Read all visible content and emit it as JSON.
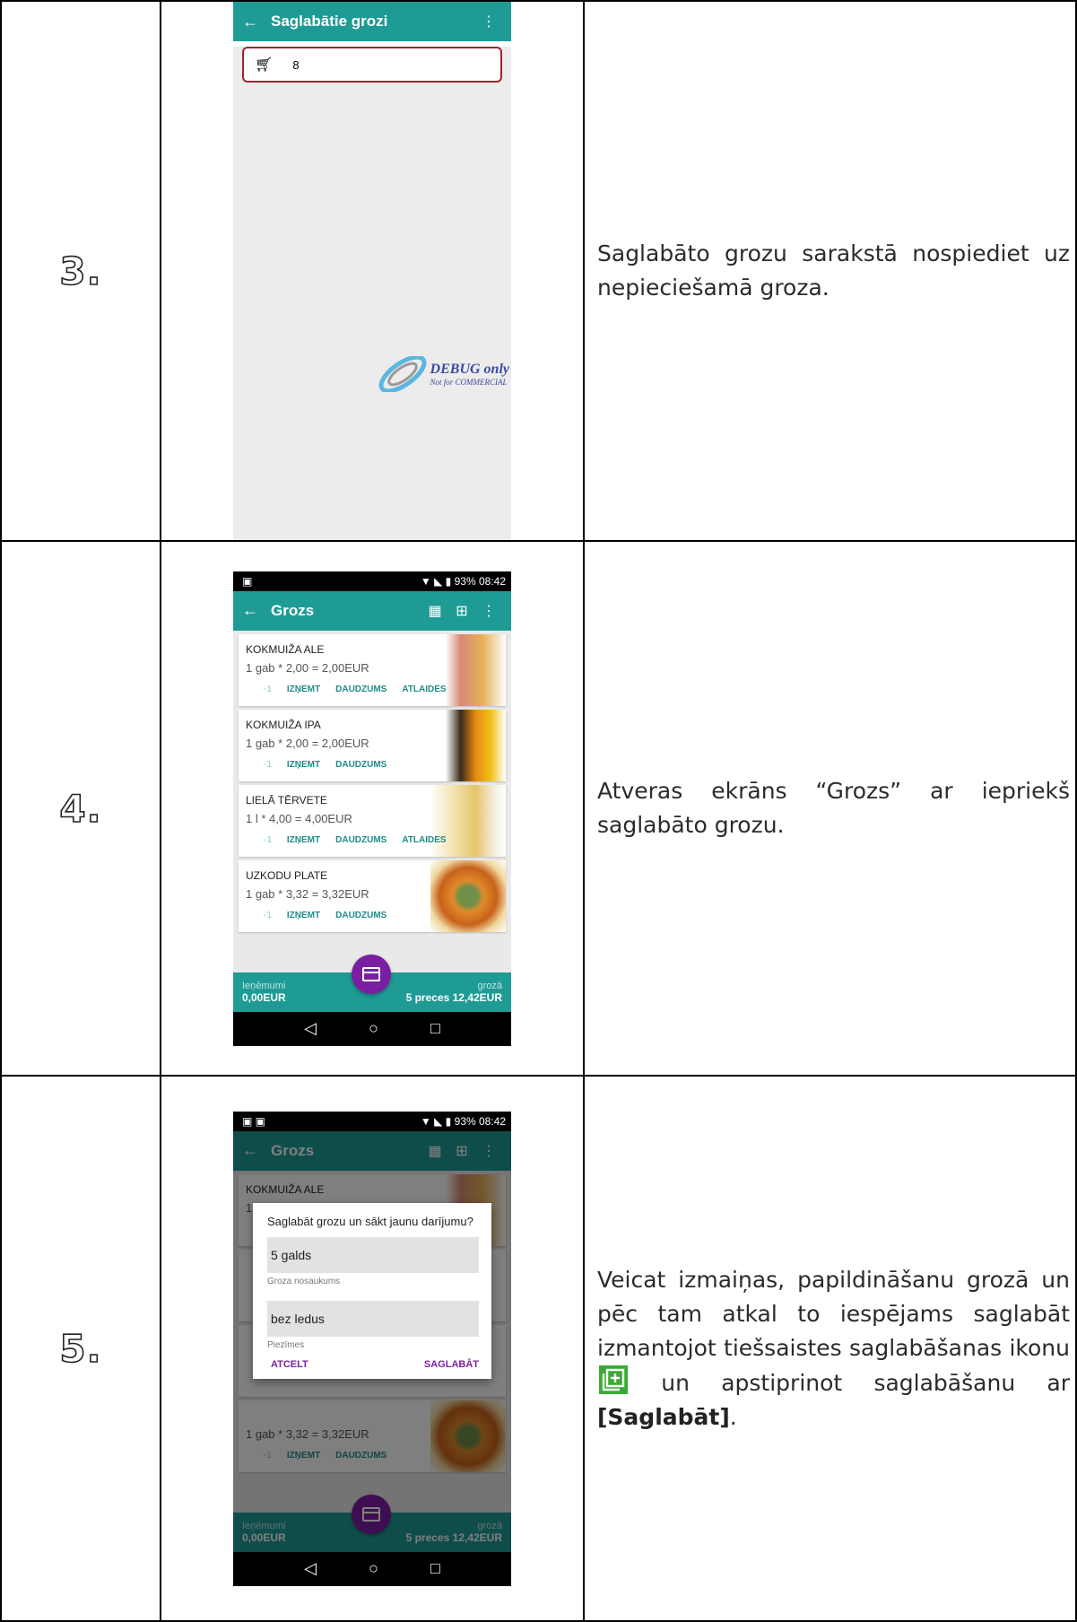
{
  "rows": [
    {
      "step": "3.",
      "description": "Saglabāto grozu sarakstā nospiediet uz nepieciešamā groza."
    },
    {
      "step": "4.",
      "description": "Atveras ekrāns “Grozs” ar iepriekš saglabāto grozu."
    },
    {
      "step": "5.",
      "description_part1": "Veicat izmaiņas, papildināšanu grozā un pēc tam atkal to iespējams saglabāt izmantojot tiešsaistes saglabāšanas ikonu",
      "description_part2": "un apstiprinot saglabāšanu ar",
      "description_bold": "[Saglabāt]",
      "description_end": "."
    }
  ],
  "screen3": {
    "title": "Saglabātie grozi",
    "list_item": "8",
    "watermark_1": "DEBUG only",
    "watermark_2": "Not for COMMERCIAL"
  },
  "status_bar": {
    "battery": "93%",
    "time": "08:42"
  },
  "cart_screen": {
    "title": "Grozs",
    "items": [
      {
        "name": "KOKMUIŽA ALE",
        "price": "1 gab * 2,00 = 2,00EUR",
        "btn_minus": "-1",
        "btn_remove": "IZŅEMT",
        "btn_qty": "DAUDZUMS",
        "btn_discount": "ATLAIDES"
      },
      {
        "name": "KOKMUIŽA IPA",
        "price": "1 gab * 2,00 = 2,00EUR",
        "btn_minus": "-1",
        "btn_remove": "IZŅEMT",
        "btn_qty": "DAUDZUMS"
      },
      {
        "name": "LIELĀ TĒRVETE",
        "price": "1 l * 4,00 = 4,00EUR",
        "btn_minus": "-1",
        "btn_remove": "IZŅEMT",
        "btn_qty": "DAUDZUMS",
        "btn_discount": "ATLAIDES"
      },
      {
        "name": "UZKODU PLATE",
        "price": "1 gab * 3,32 = 3,32EUR",
        "btn_minus": "-1",
        "btn_remove": "IZŅEMT",
        "btn_qty": "DAUDZUMS"
      }
    ],
    "summary_left_label": "Ieņēmumi",
    "summary_left_value": "0,00EUR",
    "summary_right_label": "grozā",
    "summary_right_value": "5 preces 12,42EUR"
  },
  "dialog": {
    "question": "Saglabāt grozu un sākt jaunu darījumu?",
    "name_value": "5 galds",
    "name_label": "Groza nosaukums",
    "notes_value": "bez ledus",
    "notes_label": "Piezīmes",
    "cancel": "ATCELT",
    "save": "SAGLABĀT"
  },
  "colors": {
    "teal": "#1f9b96",
    "purple": "#7b1fa2",
    "highlight": "#a3232b",
    "save_icon": "#3aaa35"
  }
}
